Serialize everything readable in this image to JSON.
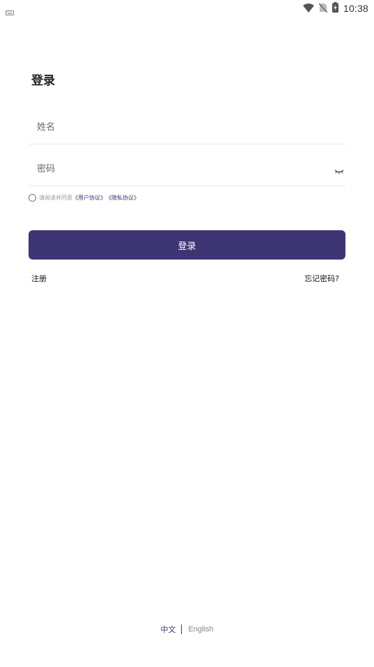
{
  "status_bar": {
    "time": "10:38",
    "icons": [
      "keyboard-icon",
      "wifi-icon",
      "no-sim-icon",
      "battery-charging-icon"
    ]
  },
  "login": {
    "title": "登录",
    "name_placeholder": "姓名",
    "password_placeholder": "密码",
    "password_toggle_icon": "eye-closed-icon",
    "agreement_prefix": "请阅读并同意",
    "user_agreement_link": "《用户协议》",
    "privacy_policy_link": "《隐私协议》",
    "submit_label": "登录",
    "register_label": "注册",
    "forgot_password_label": "忘记密码?"
  },
  "language": {
    "chinese": "中文",
    "english": "English"
  },
  "colors": {
    "primary": "#3e3574",
    "background": "#ffffff"
  }
}
